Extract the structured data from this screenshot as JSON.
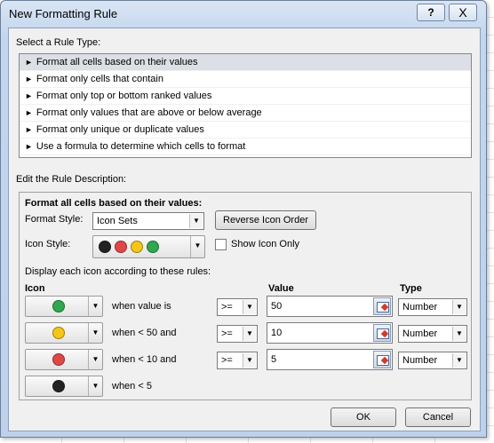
{
  "dialog": {
    "title": "New Formatting Rule",
    "help_glyph": "?",
    "close_glyph": "X"
  },
  "rule_type": {
    "heading": "Select a Rule Type:",
    "items": [
      "Format all cells based on their values",
      "Format only cells that contain",
      "Format only top or bottom ranked values",
      "Format only values that are above or below average",
      "Format only unique or duplicate values",
      "Use a formula to determine which cells to format"
    ],
    "selected_index": 0
  },
  "description": {
    "heading": "Edit the Rule Description:",
    "subheading": "Format all cells based on their values:",
    "format_style_label": "Format Style:",
    "format_style_value": "Icon Sets",
    "reverse_button": "Reverse Icon Order",
    "icon_style_label": "Icon Style:",
    "show_icon_only_label": "Show Icon Only",
    "show_icon_only_checked": false,
    "rules_intro": "Display each icon according to these rules:",
    "col_icon": "Icon",
    "col_value": "Value",
    "col_type": "Type",
    "rows": [
      {
        "icon_color": "#2fa84f",
        "condition": "when value is",
        "operator": ">=",
        "value": "50",
        "type": "Number"
      },
      {
        "icon_color": "#f5c518",
        "condition": "when < 50 and",
        "operator": ">=",
        "value": "10",
        "type": "Number"
      },
      {
        "icon_color": "#e04848",
        "condition": "when < 10 and",
        "operator": ">=",
        "value": "5",
        "type": "Number"
      },
      {
        "icon_color": "#222222",
        "condition": "when < 5"
      }
    ],
    "icon_style_colors": [
      "#222222",
      "#e04848",
      "#f5c518",
      "#2fa84f"
    ]
  },
  "footer": {
    "ok": "OK",
    "cancel": "Cancel"
  }
}
